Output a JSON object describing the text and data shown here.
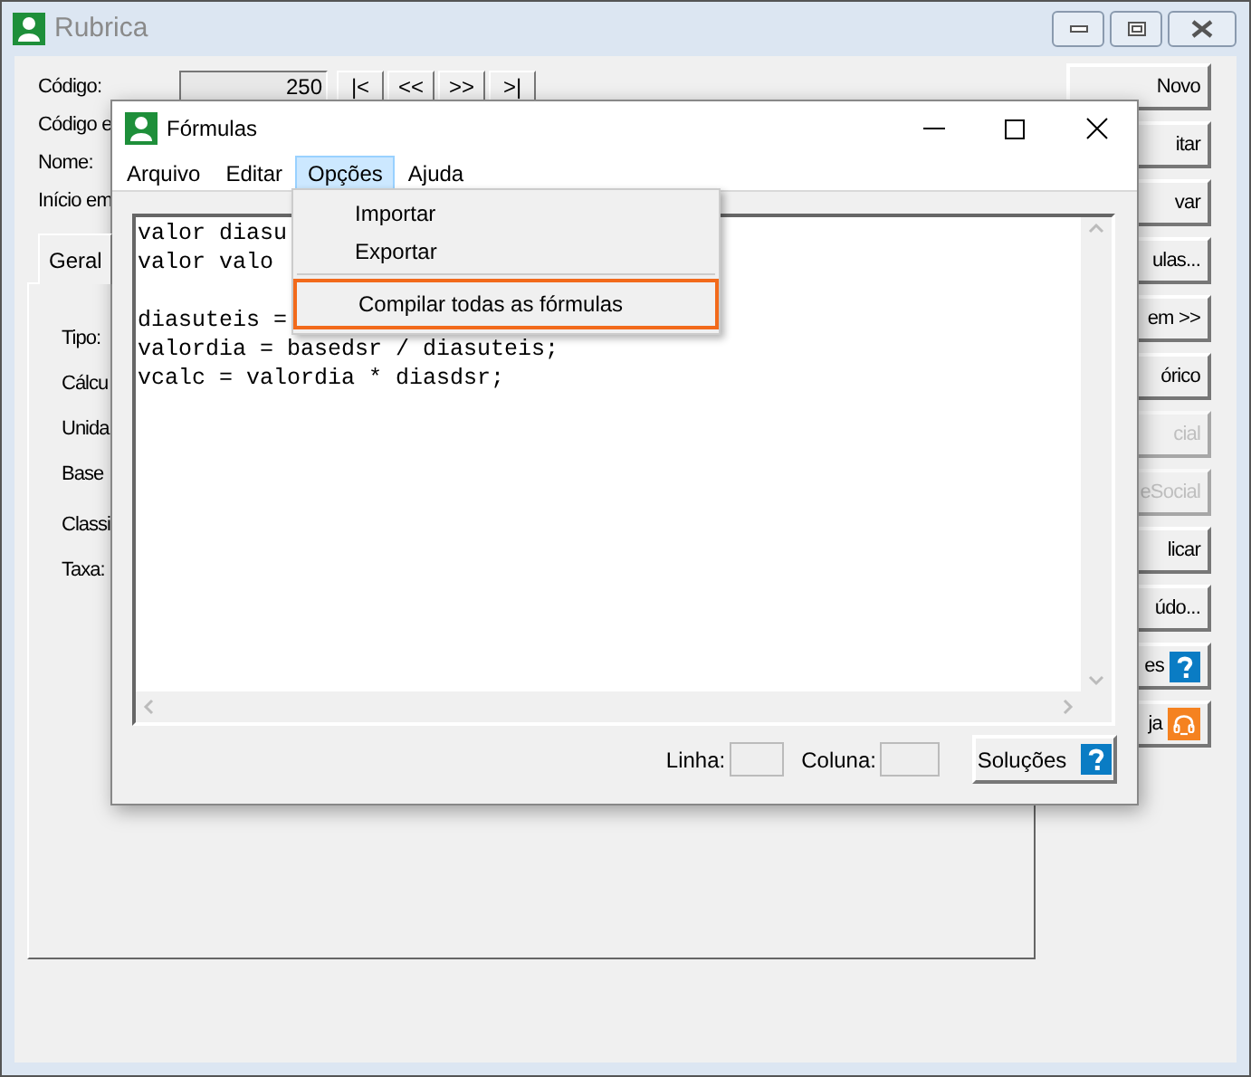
{
  "back_window": {
    "title": "Rubrica",
    "active": false,
    "fields": [
      {
        "kind": "code",
        "label": "Código:",
        "value": "250"
      },
      {
        "kind": "label",
        "label": "Código e"
      },
      {
        "kind": "label",
        "label": "Nome:"
      },
      {
        "kind": "label",
        "label": "Início em"
      }
    ],
    "nav_buttons": [
      "|<",
      "<<",
      ">>",
      ">|"
    ],
    "tabs": [
      {
        "label": "Geral",
        "selected": true
      }
    ],
    "tab_labels": [
      "Tipo:",
      "Cálcu",
      "Unida",
      "Base",
      "Classi",
      "Taxa:"
    ],
    "side_buttons": [
      {
        "label": "Novo",
        "disabled": false
      },
      {
        "label": "itar",
        "disabled": false
      },
      {
        "label": "var",
        "disabled": false
      },
      {
        "label": "ulas...",
        "disabled": false
      },
      {
        "label": "em >>",
        "disabled": false
      },
      {
        "label": "órico",
        "disabled": false
      },
      {
        "label": "cial",
        "disabled": true
      },
      {
        "label": "eSocial",
        "disabled": true
      },
      {
        "label": "licar",
        "disabled": false
      },
      {
        "label": "údo...",
        "disabled": false
      },
      {
        "label": "es",
        "disabled": false,
        "kind": "help"
      },
      {
        "label": "ja",
        "disabled": false,
        "kind": "support"
      }
    ]
  },
  "formulas_window": {
    "title": "Fórmulas",
    "active": true,
    "menu": [
      {
        "label": "Arquivo",
        "selected": false
      },
      {
        "label": "Editar",
        "selected": false
      },
      {
        "label": "Opções",
        "selected": true
      },
      {
        "label": "Ajuda",
        "selected": false
      }
    ],
    "code_lines": [
      {
        "text": "valor diasu",
        "blank_before": false
      },
      {
        "text": "valor valo",
        "blank_before": false
      },
      {
        "text": "diasuteis =",
        "blank_before": true
      },
      {
        "text": "valordia = basedsr / diasuteis;",
        "blank_before": false
      },
      {
        "text": "vcalc = valordia * diasdsr;",
        "blank_before": false
      }
    ],
    "line_label": "Linha:",
    "column_label": "Coluna:",
    "solutions_button": "Soluções"
  },
  "dropdown": {
    "items": [
      {
        "kind": "item",
        "label": "Importar",
        "highlighted": false
      },
      {
        "kind": "item",
        "label": "Exportar",
        "highlighted": false
      },
      {
        "kind": "separator"
      },
      {
        "kind": "item",
        "label": "Compilar todas as fórmulas",
        "highlighted": true
      }
    ]
  }
}
